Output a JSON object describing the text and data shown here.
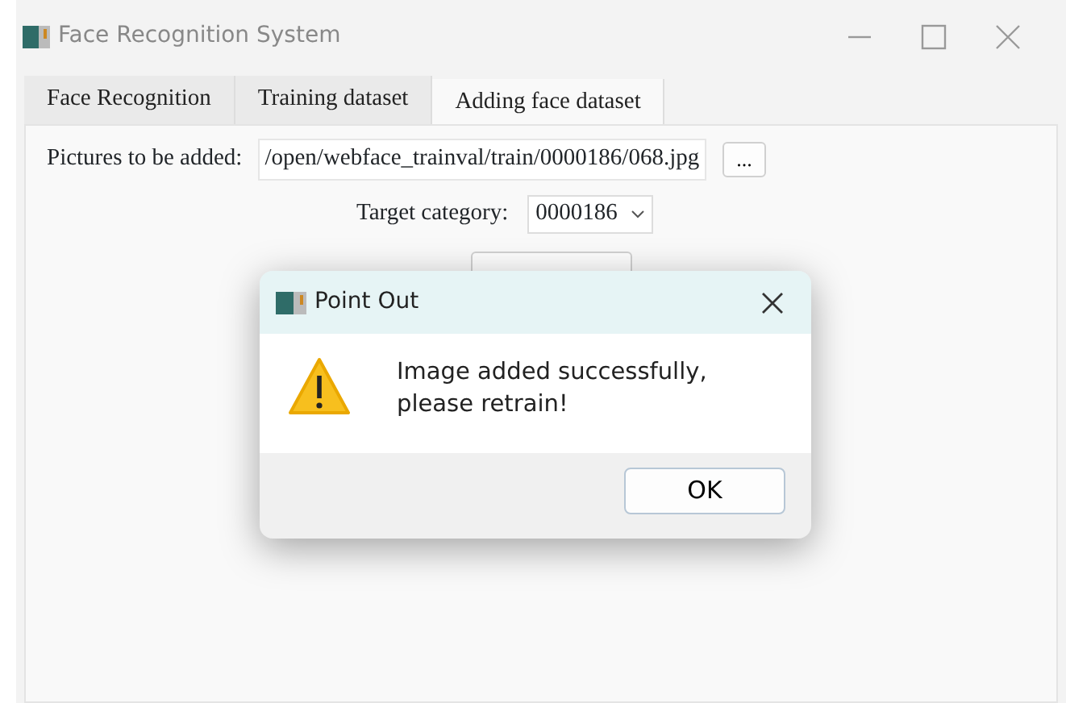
{
  "window": {
    "title": "Face Recognition System"
  },
  "tabs": [
    {
      "label": "Face Recognition",
      "selected": false
    },
    {
      "label": "Training dataset",
      "selected": false
    },
    {
      "label": "Adding face dataset",
      "selected": true
    }
  ],
  "form": {
    "picture_label": "Pictures to be added:",
    "picture_path": "/open/webface_trainval/train/0000186/068.jpg",
    "browse_button": "...",
    "category_label": "Target category:",
    "category_value": "0000186"
  },
  "dialog": {
    "title": "Point Out",
    "message": "Image added successfully,\nplease retrain!",
    "ok_button": "OK"
  }
}
